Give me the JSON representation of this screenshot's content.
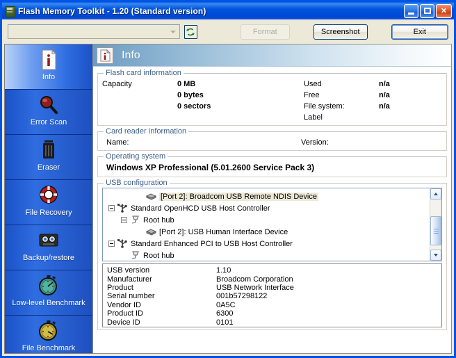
{
  "window": {
    "title": "Flash Memory Toolkit - 1.20 (Standard version)",
    "icon": "flash-card-icon",
    "minimize_label": "Minimize",
    "maximize_label": "Maximize",
    "close_label": "Close",
    "close_glyph": "✕"
  },
  "toolbar": {
    "device_combo_value": "",
    "device_combo_placeholder": "",
    "refresh_icon": "refresh-icon",
    "format_label": "Format",
    "screenshot_label": "Screenshot",
    "exit_label": "Exit"
  },
  "sidebar": {
    "items": [
      {
        "label": "Info",
        "icon": "info-document-icon",
        "selected": true
      },
      {
        "label": "Error Scan",
        "icon": "magnifier-icon",
        "selected": false
      },
      {
        "label": "Eraser",
        "icon": "trash-bin-icon",
        "selected": false
      },
      {
        "label": "File Recovery",
        "icon": "life-ring-icon",
        "selected": false
      },
      {
        "label": "Backup/restore",
        "icon": "cassette-tape-icon",
        "selected": false
      },
      {
        "label": "Low-level Benchmark",
        "icon": "stopwatch-teal-icon",
        "selected": false
      },
      {
        "label": "File Benchmark",
        "icon": "stopwatch-yellow-icon",
        "selected": false
      }
    ]
  },
  "page": {
    "title": "Info",
    "icon": "info-document-icon"
  },
  "flash_card": {
    "legend": "Flash card information",
    "capacity_label": "Capacity",
    "capacity_mb": "0 MB",
    "capacity_bytes": "0 bytes",
    "capacity_sectors": "0 sectors",
    "used_label": "Used",
    "used_value": "n/a",
    "free_label": "Free",
    "free_value": "n/a",
    "filesystem_label": "File system:",
    "filesystem_value": "n/a",
    "label_label": "Label",
    "label_value": ""
  },
  "card_reader": {
    "legend": "Card reader information",
    "name_label": "Name:",
    "name_value": "",
    "version_label": "Version:",
    "version_value": ""
  },
  "operating_system": {
    "legend": "Operating system",
    "value": "Windows XP Professional (5.01.2600 Service Pack 3)"
  },
  "usb_configuration": {
    "legend": "USB configuration",
    "tree": [
      {
        "indent": 2,
        "expander": "",
        "icon": "usb-device-icon",
        "label": "[Port 2]: Broadcom USB Remote NDIS Device",
        "selected": true
      },
      {
        "indent": 0,
        "expander": "minus",
        "icon": "usb-controller-icon",
        "label": "Standard OpenHCD USB Host Controller",
        "selected": false
      },
      {
        "indent": 1,
        "expander": "minus",
        "icon": "usb-hub-icon",
        "label": "Root hub",
        "selected": false
      },
      {
        "indent": 2,
        "expander": "",
        "icon": "usb-device-icon",
        "label": "[Port 2]: USB Human Interface Device",
        "selected": false
      },
      {
        "indent": 0,
        "expander": "minus",
        "icon": "usb-controller-icon",
        "label": "Standard Enhanced PCI to USB Host Controller",
        "selected": false
      },
      {
        "indent": 1,
        "expander": "",
        "icon": "usb-hub-icon",
        "label": "Root hub",
        "selected": false
      }
    ],
    "scroll_up_icon": "chevron-up-icon",
    "scroll_down_icon": "chevron-down-icon"
  },
  "device_details": {
    "rows": [
      {
        "key": "USB version",
        "value": "1.10"
      },
      {
        "key": "Manufacturer",
        "value": "Broadcom Corporation"
      },
      {
        "key": "Product",
        "value": "USB Network Interface"
      },
      {
        "key": "Serial number",
        "value": "001b57298122"
      },
      {
        "key": "Vendor ID",
        "value": "0A5C"
      },
      {
        "key": "Product ID",
        "value": "6300"
      },
      {
        "key": "Device ID",
        "value": "0101"
      }
    ]
  },
  "colors": {
    "titlebar_blue": "#0054e3",
    "sidebar_blue": "#1e4fbe",
    "accent_header": "#6c9cc2",
    "legend_text": "#3b5f87",
    "selection": "#ece9d8"
  }
}
